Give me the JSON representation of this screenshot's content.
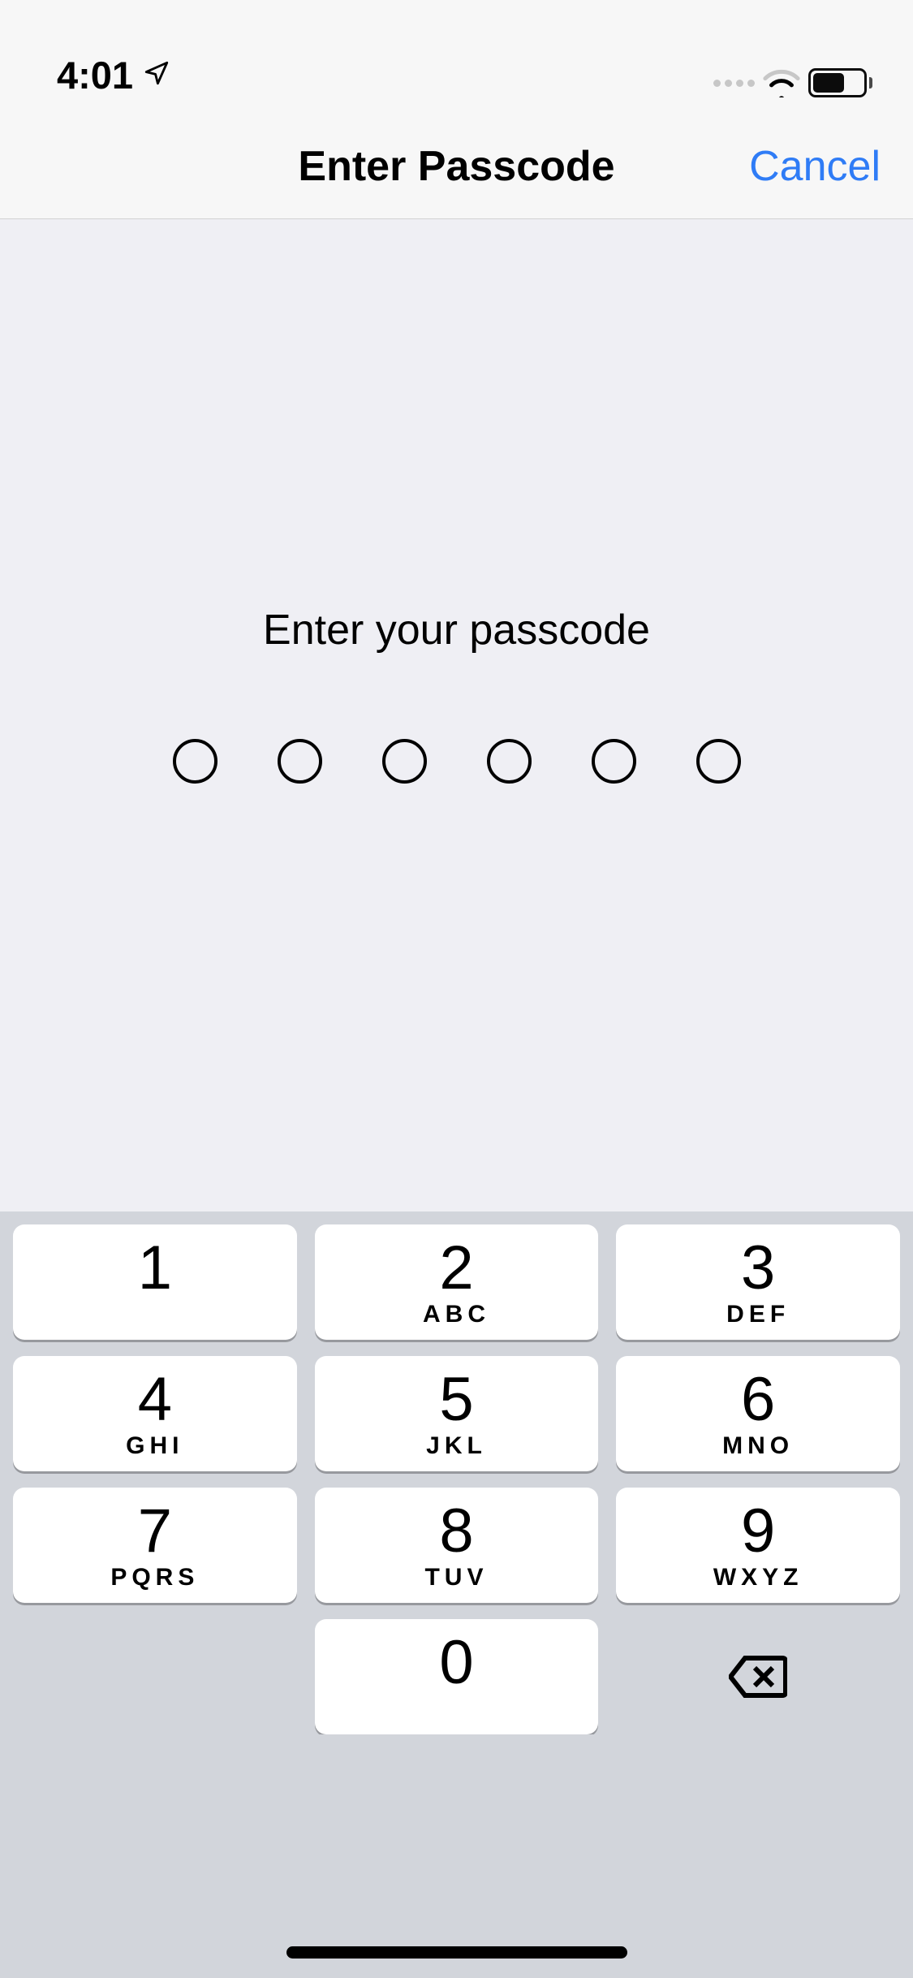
{
  "status_bar": {
    "time": "4:01"
  },
  "header": {
    "title": "Enter Passcode",
    "cancel_label": "Cancel"
  },
  "main": {
    "prompt": "Enter your passcode",
    "digit_count": 6
  },
  "keypad": {
    "keys": [
      {
        "digit": "1",
        "letters": ""
      },
      {
        "digit": "2",
        "letters": "ABC"
      },
      {
        "digit": "3",
        "letters": "DEF"
      },
      {
        "digit": "4",
        "letters": "GHI"
      },
      {
        "digit": "5",
        "letters": "JKL"
      },
      {
        "digit": "6",
        "letters": "MNO"
      },
      {
        "digit": "7",
        "letters": "PQRS"
      },
      {
        "digit": "8",
        "letters": "TUV"
      },
      {
        "digit": "9",
        "letters": "WXYZ"
      },
      {
        "digit": "0",
        "letters": ""
      }
    ]
  }
}
